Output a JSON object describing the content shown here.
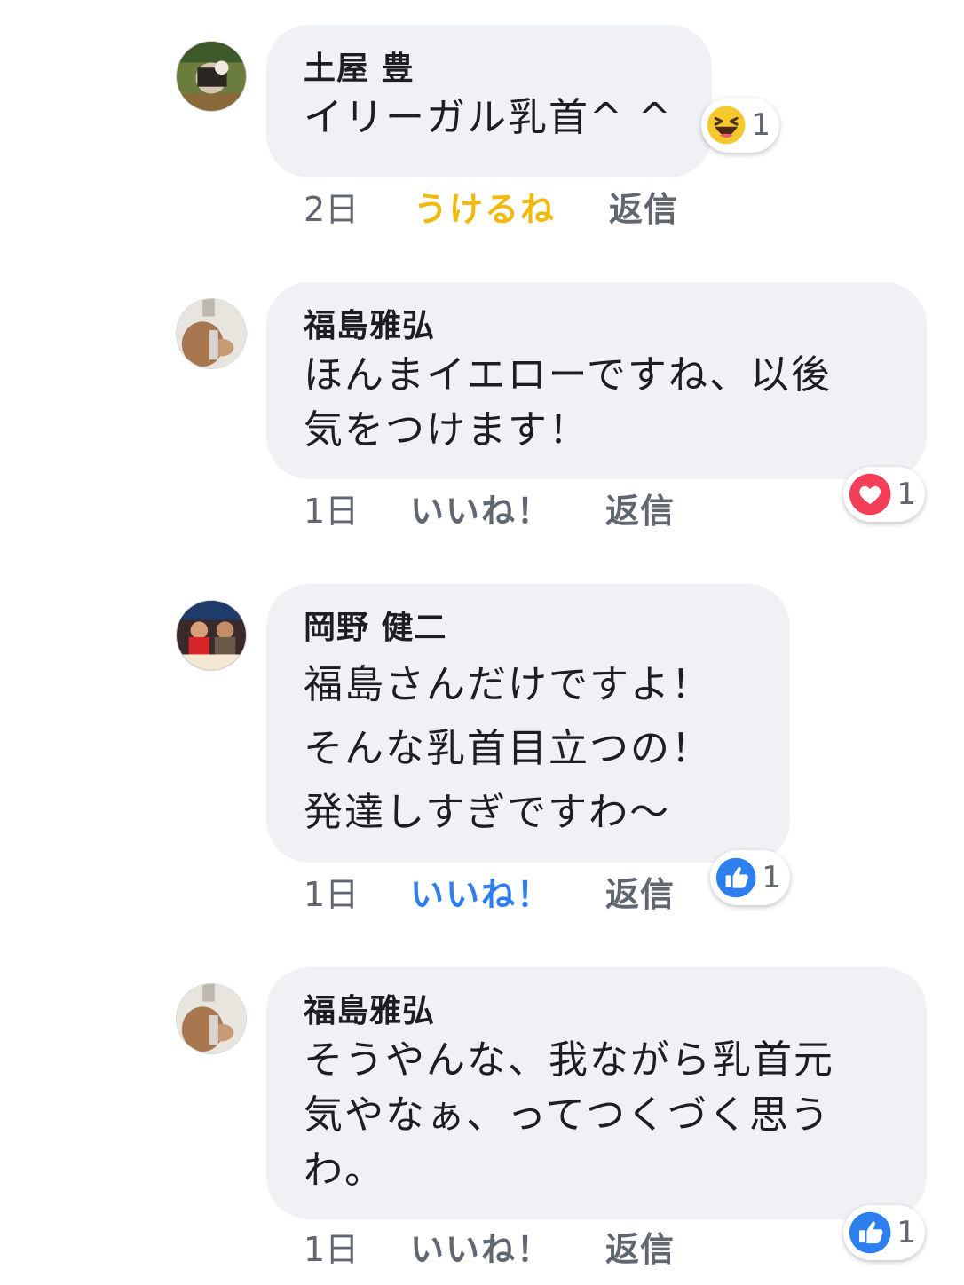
{
  "comments": [
    {
      "author": "土屋 豊",
      "text": "イリーガル乳首^ ^",
      "time": "2日",
      "like_label": "うけるね",
      "reply_label": "返信",
      "reaction": {
        "icon": "haha-icon",
        "count": "1"
      }
    },
    {
      "author": "福島雅弘",
      "text": "ほんまイエローですね、以後\n気をつけます！",
      "time": "1日",
      "like_label": "いいね！",
      "reply_label": "返信",
      "reaction": {
        "icon": "love-icon",
        "count": "1"
      }
    },
    {
      "author": "岡野 健二",
      "text": "福島さんだけですよ！\nそんな乳首目立つの！\n発達しすぎですわ〜",
      "time": "1日",
      "like_label": "いいね！",
      "reply_label": "返信",
      "reaction": {
        "icon": "like-icon",
        "count": "1"
      }
    },
    {
      "author": "福島雅弘",
      "text": "そうやんな、我ながら乳首元\n気やなぁ、ってつくづく思う\nわ。",
      "time": "1日",
      "like_label": "いいね！",
      "reply_label": "返信",
      "reaction": {
        "icon": "like-icon",
        "count": "1"
      }
    }
  ],
  "colors": {
    "bubble": "#f0f1f4",
    "meta_gray": "#606770",
    "like_blue": "#2d7ff0",
    "haha_yellow": "#f0b90b",
    "love_red": "#f33e58"
  }
}
